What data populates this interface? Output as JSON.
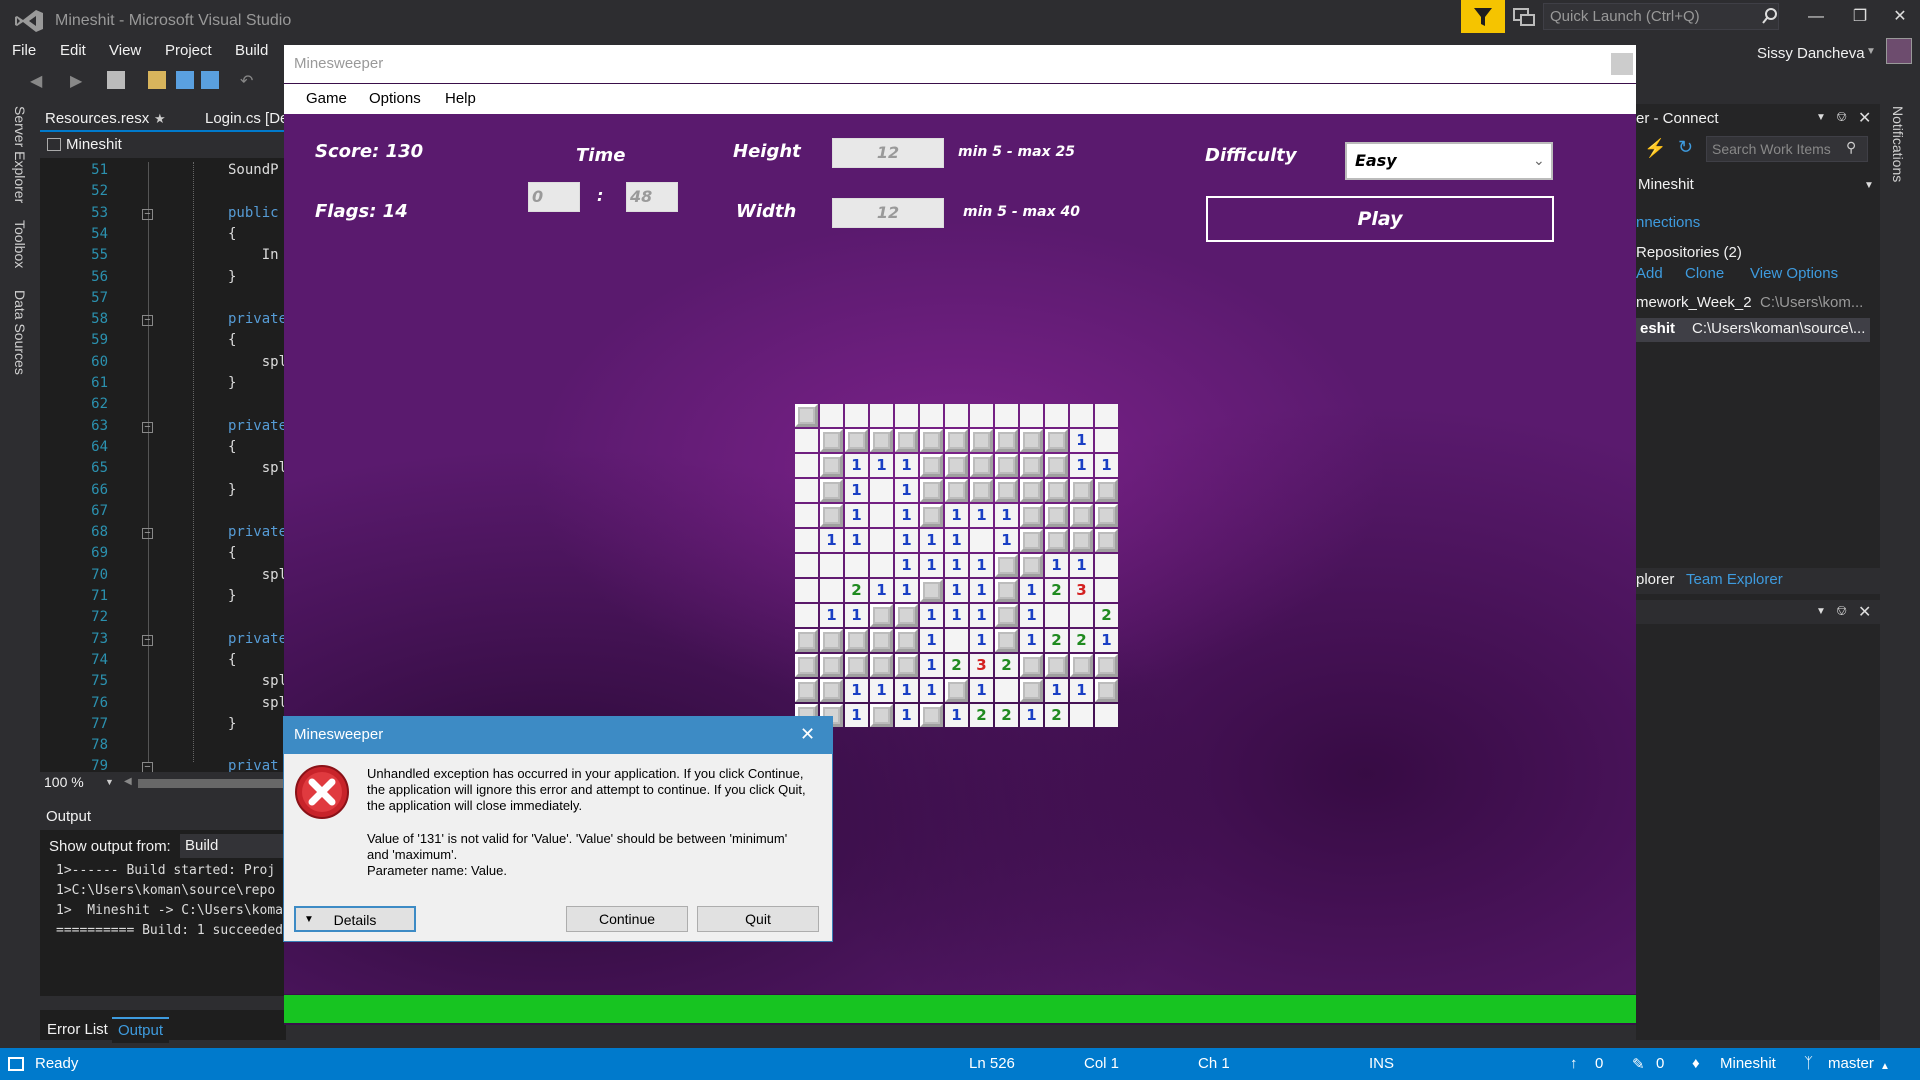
{
  "vs": {
    "title": "Mineshit - Microsoft Visual Studio",
    "quick_launch_placeholder": "Quick Launch (Ctrl+Q)",
    "menu": [
      "File",
      "Edit",
      "View",
      "Project",
      "Build"
    ],
    "user": "Sissy Dancheva",
    "side_tools": [
      "Server Explorer",
      "Toolbox",
      "Data Sources"
    ],
    "doc_tabs": [
      "Resources.resx",
      "Login.cs [De"
    ],
    "nav_class": "Mineshit",
    "code_lines": [
      {
        "n": "51",
        "text": "SoundP",
        "kw": false
      },
      {
        "n": "52",
        "text": "",
        "kw": false
      },
      {
        "n": "53",
        "text": "public",
        "kw": true
      },
      {
        "n": "54",
        "text": "{",
        "kw": false
      },
      {
        "n": "55",
        "text": "    In",
        "kw": false
      },
      {
        "n": "56",
        "text": "}",
        "kw": false
      },
      {
        "n": "57",
        "text": "",
        "kw": false
      },
      {
        "n": "58",
        "text": "private",
        "kw": true
      },
      {
        "n": "59",
        "text": "{",
        "kw": false
      },
      {
        "n": "60",
        "text": "    spl",
        "kw": false
      },
      {
        "n": "61",
        "text": "}",
        "kw": false
      },
      {
        "n": "62",
        "text": "",
        "kw": false
      },
      {
        "n": "63",
        "text": "private",
        "kw": true
      },
      {
        "n": "64",
        "text": "{",
        "kw": false
      },
      {
        "n": "65",
        "text": "    spl",
        "kw": false
      },
      {
        "n": "66",
        "text": "}",
        "kw": false
      },
      {
        "n": "67",
        "text": "",
        "kw": false
      },
      {
        "n": "68",
        "text": "private",
        "kw": true
      },
      {
        "n": "69",
        "text": "{",
        "kw": false
      },
      {
        "n": "70",
        "text": "    spl",
        "kw": false
      },
      {
        "n": "71",
        "text": "}",
        "kw": false
      },
      {
        "n": "72",
        "text": "",
        "kw": false
      },
      {
        "n": "73",
        "text": "private",
        "kw": true
      },
      {
        "n": "74",
        "text": "{",
        "kw": false
      },
      {
        "n": "75",
        "text": "    spl",
        "kw": false
      },
      {
        "n": "76",
        "text": "    spl",
        "kw": false
      },
      {
        "n": "77",
        "text": "}",
        "kw": false
      },
      {
        "n": "78",
        "text": "",
        "kw": false
      },
      {
        "n": "79",
        "text": "privat",
        "kw": true
      }
    ],
    "zoom": "100 %",
    "output": {
      "title": "Output",
      "show_from_label": "Show output from:",
      "show_from_value": "Build",
      "lines": [
        "1>------ Build started: Proj",
        "1>C:\\Users\\koman\\source\\repo",
        "1>  Mineshit -> C:\\Users\\koma",
        "========== Build: 1 succeeded"
      ]
    },
    "bottom_tabs": [
      "Error List",
      "Output"
    ],
    "team_explorer": {
      "header": "er - Connect",
      "search_placeholder": "Search Work Items",
      "project": "Mineshit",
      "connections": "nnections",
      "repositories": "Repositories (2)",
      "actions": [
        "Add",
        "Clone",
        "View Options"
      ],
      "repos": [
        {
          "name": "mework_Week_2",
          "path": "C:\\Users\\kom..."
        },
        {
          "name": "eshit",
          "path": "C:\\Users\\koman\\source\\..."
        }
      ],
      "tabs": [
        "plorer",
        "Team Explorer"
      ]
    },
    "notifications_label": "Notifications",
    "status": {
      "ready": "Ready",
      "ln": "Ln 526",
      "col": "Col 1",
      "ch": "Ch 1",
      "ins": "INS",
      "up_count": "0",
      "pencil_count": "0",
      "repo": "Mineshit",
      "branch": "master"
    }
  },
  "minesweeper": {
    "title": "Minesweeper",
    "menu": [
      "Game",
      "Options",
      "Help"
    ],
    "score_label": "Score: 130",
    "flags_label": "Flags: 14",
    "time_label": "Time",
    "time_minutes": "0",
    "time_sep": ":",
    "time_seconds": "48",
    "height_label": "Height",
    "height_value": "12",
    "height_range": "min 5 - max 25",
    "width_label": "Width",
    "width_value": "12",
    "width_range": "min 5 - max 40",
    "difficulty_label": "Difficulty",
    "difficulty_value": "Easy",
    "play_label": "Play",
    "progress_fraction": 1.0,
    "colors": {
      "progress": "#17c421",
      "one": "#1a3fc4",
      "two": "#1f8a1f",
      "three": "#d42020"
    },
    "grid": [
      "UEEEEEEEEEEEE",
      "EUUUUUUUUUU1E",
      "EU111UUUUUU11",
      "EU1E1UUUUUUUU",
      "EU1E1U111UUUU",
      "E11E111E1UUUU",
      "EEEE1111UU11E",
      "EE211U11U123E",
      "E11UU111U1EE2",
      "UUUUU1E1U1221",
      "UUUUU1232UUUU",
      "UU1111U1EU11U",
      "UU1U1U12212EE"
    ]
  },
  "error_dialog": {
    "title": "Minesweeper",
    "message1": "Unhandled exception has occurred in your application. If you click Continue, the application will ignore this error and attempt to continue. If you click Quit, the application will close immediately.",
    "message2": "Value of '131' is not valid for 'Value'. 'Value' should be between 'minimum' and 'maximum'.",
    "message3": "Parameter name: Value.",
    "details": "Details",
    "continue": "Continue",
    "quit": "Quit"
  }
}
